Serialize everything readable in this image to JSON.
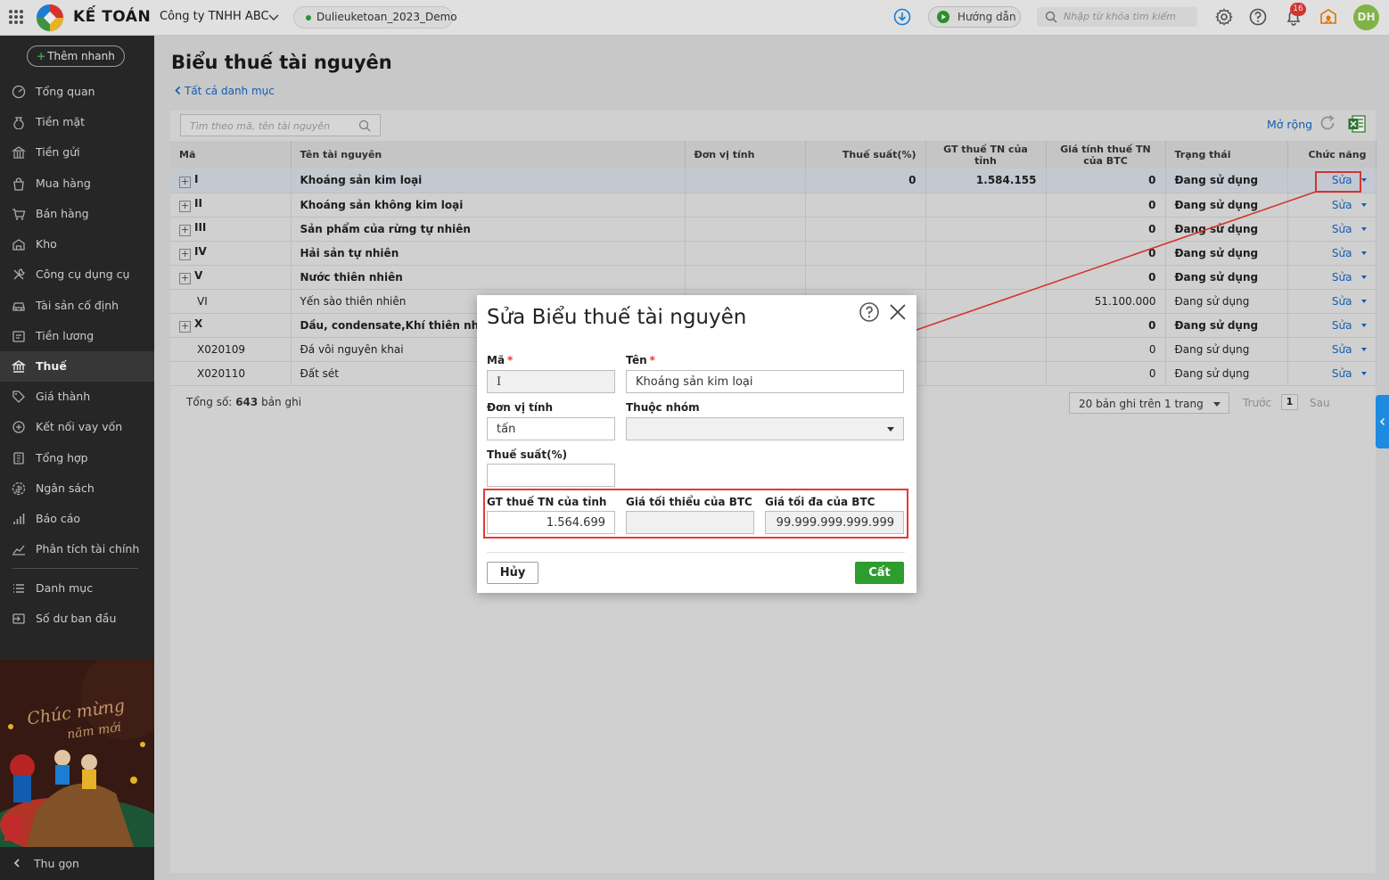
{
  "app": {
    "logo_text": "KẾ TOÁN",
    "company": "Công ty TNHH ABC",
    "database": "Dulieuketoan_2023_Demo",
    "guide_label": "Hướng dẫn",
    "search_placeholder": "Nhập từ khóa tìm kiếm",
    "notification_count": "16",
    "user_initials": "DH"
  },
  "sidebar": {
    "quick_add": "Thêm nhanh",
    "items": [
      {
        "label": "Tổng quan",
        "icon": "dashboard-icon"
      },
      {
        "label": "Tiền mặt",
        "icon": "money-bag-icon"
      },
      {
        "label": "Tiền gửi",
        "icon": "bank-icon"
      },
      {
        "label": "Mua hàng",
        "icon": "shopping-bag-icon"
      },
      {
        "label": "Bán hàng",
        "icon": "cart-icon"
      },
      {
        "label": "Kho",
        "icon": "warehouse-icon"
      },
      {
        "label": "Công cụ dụng cụ",
        "icon": "tools-icon"
      },
      {
        "label": "Tài sản cố định",
        "icon": "car-icon"
      },
      {
        "label": "Tiền lương",
        "icon": "payroll-icon"
      },
      {
        "label": "Thuế",
        "icon": "tax-icon"
      },
      {
        "label": "Giá thành",
        "icon": "price-tag-icon"
      },
      {
        "label": "Kết nối vay vốn",
        "icon": "loan-icon"
      },
      {
        "label": "Tổng hợp",
        "icon": "ledger-icon"
      },
      {
        "label": "Ngân sách",
        "icon": "budget-icon"
      },
      {
        "label": "Báo cáo",
        "icon": "bar-chart-icon"
      },
      {
        "label": "Phân tích tài chính",
        "icon": "trend-icon"
      },
      {
        "label": "Danh mục",
        "icon": "list-icon"
      },
      {
        "label": "Số dư ban đầu",
        "icon": "opening-balance-icon"
      }
    ],
    "active_item": "Thuế",
    "collapse_label": "Thu gọn",
    "banner_text_1": "Chúc mừng",
    "banner_text_2": "năm mới"
  },
  "page": {
    "title": "Biểu thuế tài nguyên",
    "breadcrumb": "Tất cả danh mục",
    "list_search_placeholder": "Tìm theo mã, tên tài nguyên",
    "expand_label": "Mở rộng"
  },
  "table": {
    "columns": [
      "Mã",
      "Tên tài nguyên",
      "Đơn vị tính",
      "Thuế suất(%)",
      "GT thuế TN của tỉnh",
      "Giá tính thuế TN của BTC",
      "Trạng thái",
      "Chức năng"
    ],
    "rows": [
      {
        "code": "I",
        "name": "Khoáng sản kim loại",
        "unit": "",
        "rate": "0",
        "province_value": "1.584.155",
        "btc_price": "0",
        "status": "Đang sử dụng",
        "action": "Sửa",
        "group": true
      },
      {
        "code": "II",
        "name": "Khoáng sản không kim loại",
        "unit": "",
        "rate": "",
        "province_value": "",
        "btc_price": "0",
        "status": "Đang sử dụng",
        "action": "Sửa",
        "group": true
      },
      {
        "code": "III",
        "name": "Sản phẩm của rừng tự nhiên",
        "unit": "",
        "rate": "",
        "province_value": "",
        "btc_price": "0",
        "status": "Đang sử dụng",
        "action": "Sửa",
        "group": true
      },
      {
        "code": "IV",
        "name": "Hải sản tự nhiên",
        "unit": "",
        "rate": "",
        "province_value": "",
        "btc_price": "0",
        "status": "Đang sử dụng",
        "action": "Sửa",
        "group": true
      },
      {
        "code": "V",
        "name": "Nước thiên nhiên",
        "unit": "",
        "rate": "",
        "province_value": "",
        "btc_price": "0",
        "status": "Đang sử dụng",
        "action": "Sửa",
        "group": true
      },
      {
        "code": "VI",
        "name": "Yến sào thiên nhiên",
        "unit": "",
        "rate": "",
        "province_value": "",
        "btc_price": "51.100.000",
        "status": "Đang sử dụng",
        "action": "Sửa",
        "group": false
      },
      {
        "code": "X",
        "name": "Dầu, condensate,Khí thiên nhiên, K",
        "unit": "",
        "rate": "",
        "province_value": "",
        "btc_price": "0",
        "status": "Đang sử dụng",
        "action": "Sửa",
        "group": true
      },
      {
        "code": "X020109",
        "name": "Đá vôi nguyên khai",
        "unit": "",
        "rate": "",
        "province_value": "",
        "btc_price": "0",
        "status": "Đang sử dụng",
        "action": "Sửa",
        "group": false
      },
      {
        "code": "X020110",
        "name": "Đất sét",
        "unit": "",
        "rate": "",
        "province_value": "",
        "btc_price": "0",
        "status": "Đang sử dụng",
        "action": "Sửa",
        "group": false
      }
    ],
    "total_prefix": "Tổng số:",
    "total_count": "643",
    "total_suffix": "bản ghi",
    "page_size": "20 bản ghi trên 1 trang",
    "prev": "Trước",
    "current_page": "1",
    "next": "Sau"
  },
  "dialog": {
    "title": "Sửa Biểu thuế tài nguyên",
    "code_label": "Mã",
    "code_value": "I",
    "name_label": "Tên",
    "name_value": "Khoáng sản kim loại",
    "unit_label": "Đơn vị tính",
    "unit_value": "tấn",
    "group_label": "Thuộc nhóm",
    "group_value": "",
    "rate_label": "Thuế suất(%)",
    "rate_value": "",
    "province_label": "GT thuế TN của tỉnh",
    "province_value": "1.564.699",
    "min_label": "Giá tối thiểu của BTC",
    "min_value": "",
    "max_label": "Giá tối đa của BTC",
    "max_value": "99.999.999.999.999",
    "cancel": "Hủy",
    "save": "Cất"
  },
  "colors": {
    "sidebar_bg": "#2a2a2a",
    "link": "#1565c0",
    "save_button": "#2e9c2e",
    "highlight": "#e53935",
    "avatar": "#8bc34a"
  }
}
